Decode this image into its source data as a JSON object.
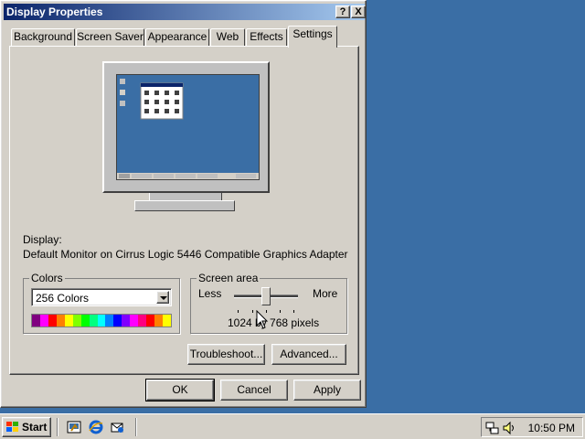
{
  "window": {
    "title": "Display Properties",
    "help_button": "?",
    "close_button": "X"
  },
  "tabs": [
    {
      "label": "Background"
    },
    {
      "label": "Screen Saver"
    },
    {
      "label": "Appearance"
    },
    {
      "label": "Web"
    },
    {
      "label": "Effects"
    },
    {
      "label": "Settings",
      "active": true
    }
  ],
  "display": {
    "label": "Display:",
    "adapter": "Default Monitor on Cirrus Logic 5446 Compatible Graphics Adapter"
  },
  "colors": {
    "legend": "Colors",
    "selected": "256 Colors",
    "bar": [
      "#800080",
      "#ff00ff",
      "#ff0000",
      "#ff8000",
      "#ffff00",
      "#80ff00",
      "#00ff00",
      "#00ff80",
      "#00ffff",
      "#0080ff",
      "#0000ff",
      "#8000ff",
      "#ff00ff",
      "#ff0080",
      "#ff0000",
      "#ff8000",
      "#ffff00"
    ]
  },
  "screen_area": {
    "legend": "Screen area",
    "less": "Less",
    "more": "More",
    "resolution": "1024 by 768 pixels",
    "slider_level": 0.5
  },
  "buttons": {
    "troubleshoot": "Troubleshoot...",
    "advanced": "Advanced...",
    "ok": "OK",
    "cancel": "Cancel",
    "apply": "Apply"
  },
  "taskbar": {
    "start": "Start",
    "clock": "10:50 PM"
  },
  "colors_theme": {
    "desktop": "#3a6ea5",
    "face": "#d4d0c8",
    "titlebar_start": "#0a246a",
    "titlebar_end": "#a6caf0"
  }
}
